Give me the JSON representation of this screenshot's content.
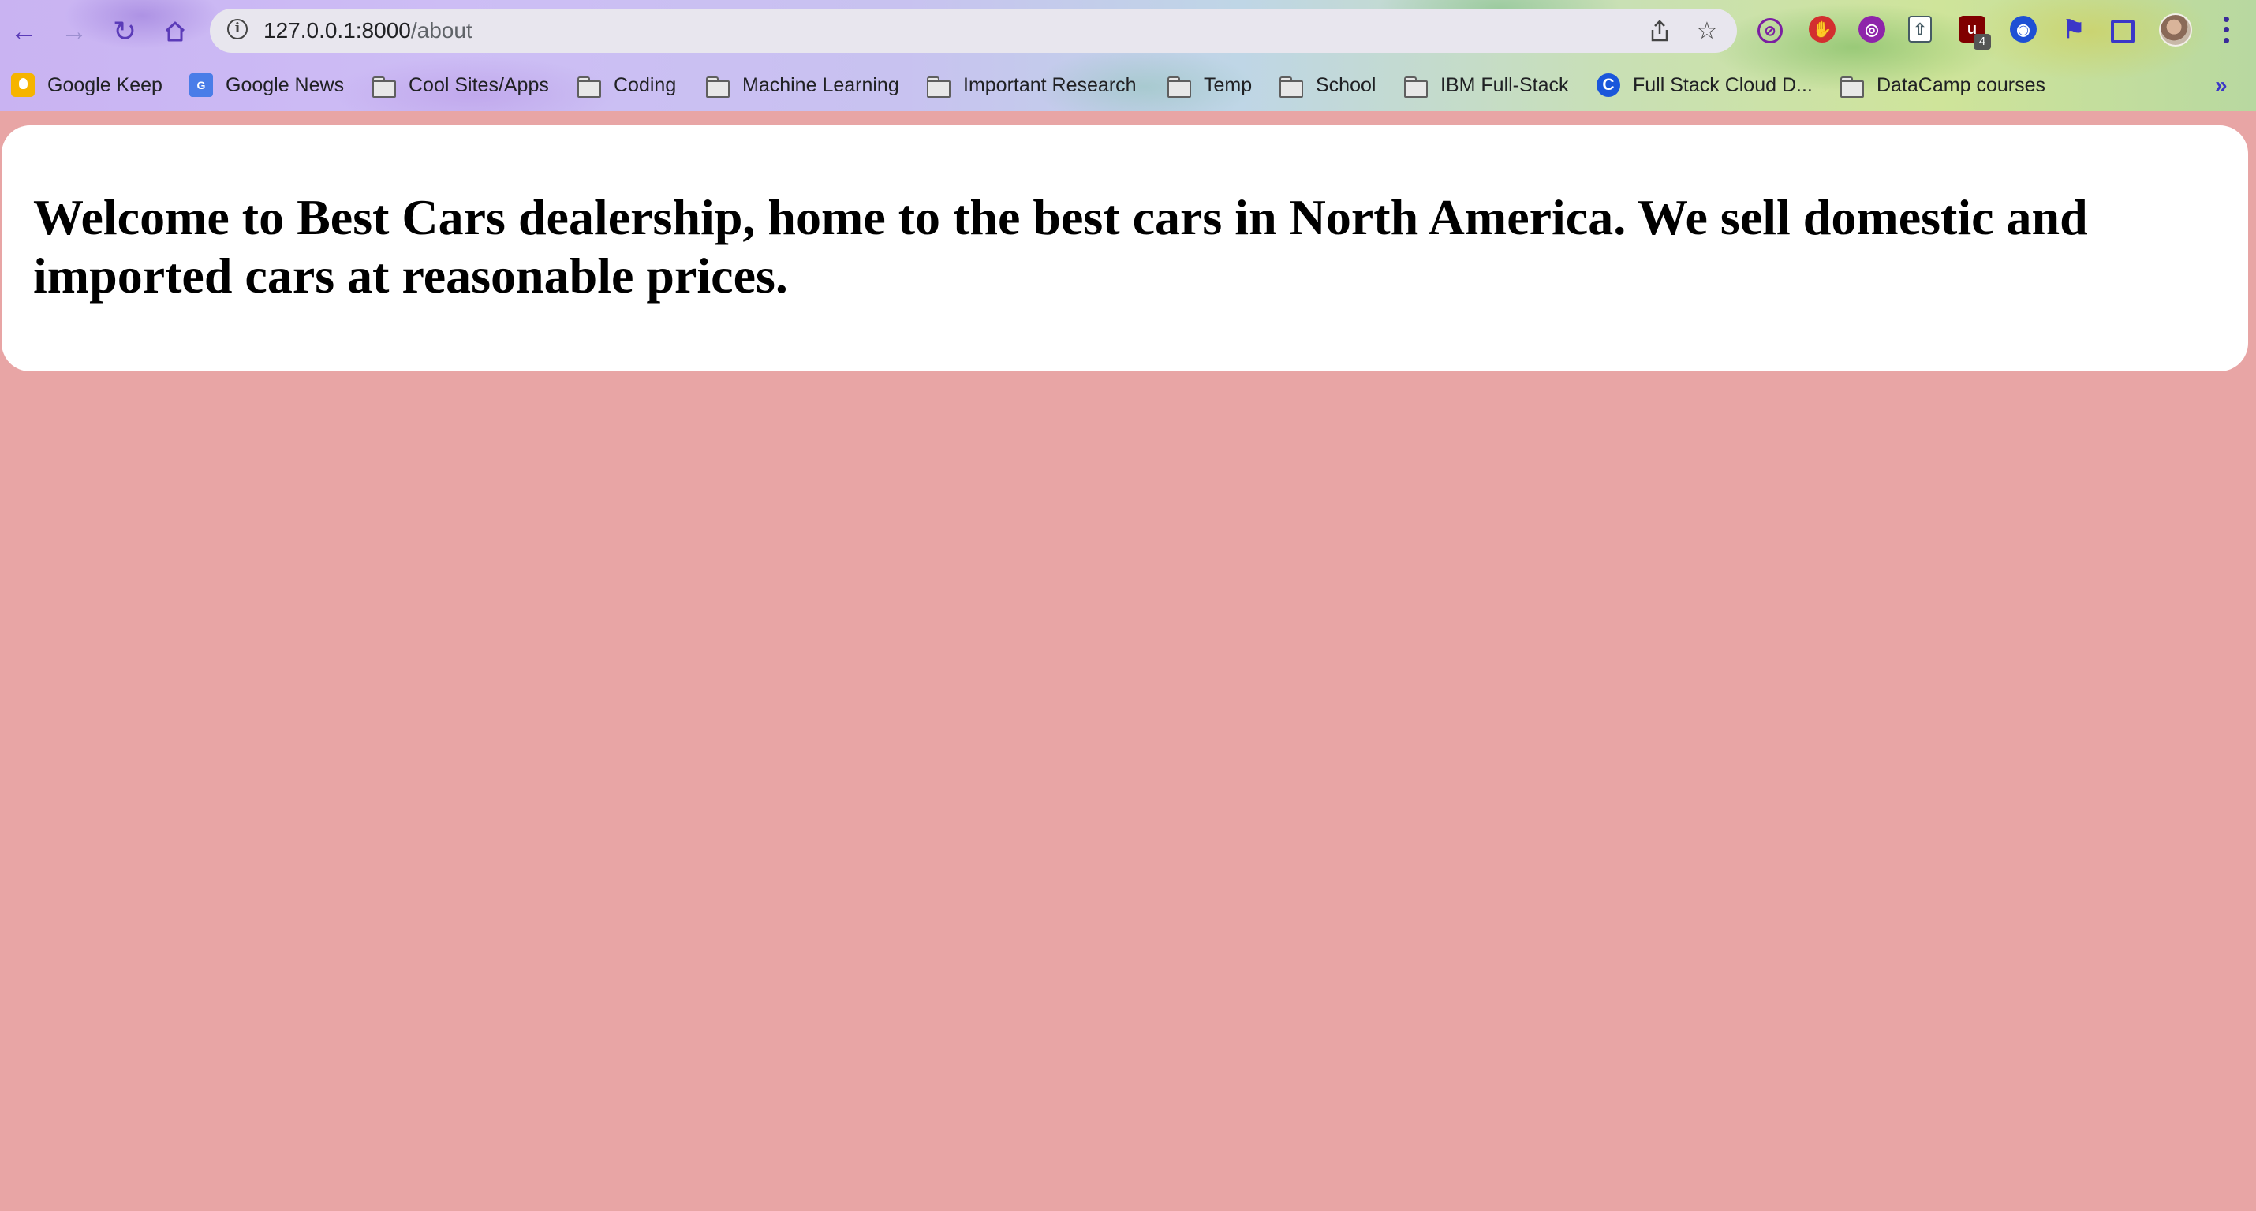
{
  "browser": {
    "url_host": "127.0.0.1:8000",
    "url_path": "/about",
    "nav_icons": {
      "back": "arrow-left-icon",
      "forward": "arrow-right-icon",
      "reload": "reload-icon",
      "home": "home-icon"
    },
    "extensions": [
      {
        "name": "block-icon",
        "color": "#7b1fa2"
      },
      {
        "name": "hand-stop-icon",
        "color": "#d32f2f"
      },
      {
        "name": "globe-extension-icon",
        "color": "#8e24aa"
      },
      {
        "name": "upload-extension-icon",
        "color": "#455a64"
      },
      {
        "name": "ublock-icon",
        "color": "#800000",
        "badge": "4"
      },
      {
        "name": "circle-target-icon",
        "color": "#1e50d4"
      },
      {
        "name": "puzzle-icon",
        "color": "#3b37c8"
      },
      {
        "name": "side-panel-icon",
        "color": "#3b37c8"
      }
    ]
  },
  "bookmarks": [
    {
      "label": "Google Keep",
      "icon": "keep-icon"
    },
    {
      "label": "Google News",
      "icon": "news-icon"
    },
    {
      "label": "Cool Sites/Apps",
      "icon": "folder-icon"
    },
    {
      "label": "Coding",
      "icon": "folder-icon"
    },
    {
      "label": "Machine Learning",
      "icon": "folder-icon"
    },
    {
      "label": "Important Research",
      "icon": "folder-icon"
    },
    {
      "label": "Temp",
      "icon": "folder-icon"
    },
    {
      "label": "School",
      "icon": "folder-icon"
    },
    {
      "label": "IBM Full-Stack",
      "icon": "folder-icon"
    },
    {
      "label": "Full Stack Cloud D...",
      "icon": "coursera-icon"
    },
    {
      "label": "DataCamp courses",
      "icon": "folder-icon"
    }
  ],
  "bookmarks_more": "»",
  "page": {
    "heading": "Welcome to Best Cars dealership, home to the best cars in North America. We sell domestic and imported cars at reasonable prices.",
    "background_color": "#e8a5a5"
  }
}
